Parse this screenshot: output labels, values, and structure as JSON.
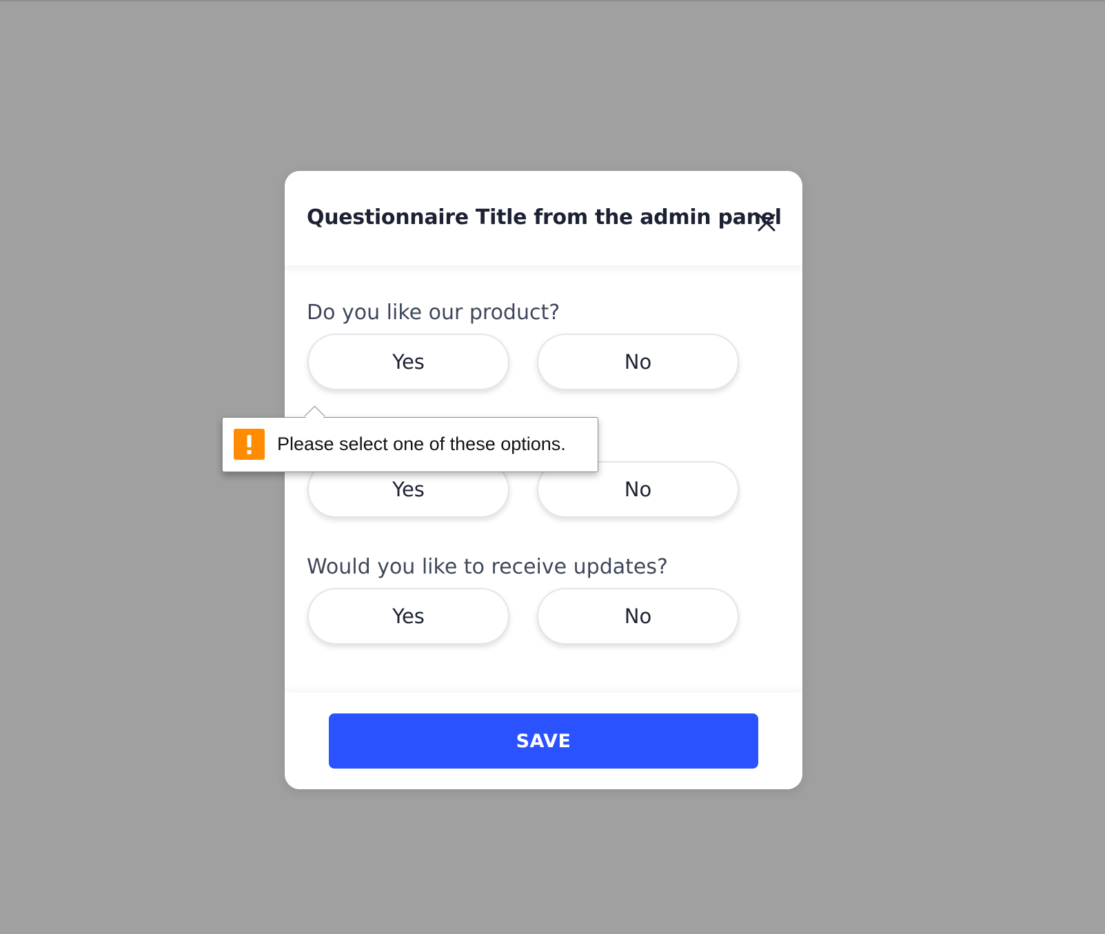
{
  "dialog": {
    "title": "Questionnaire Title from the admin panel",
    "close_icon": "close-icon"
  },
  "questions": [
    {
      "text": "Do you like our product?",
      "yes": "Yes",
      "no": "No"
    },
    {
      "text": "",
      "yes": "Yes",
      "no": "No"
    },
    {
      "text": "Would you like to receive updates?",
      "yes": "Yes",
      "no": "No"
    }
  ],
  "validation_tooltip": {
    "message": "Please select one of these options.",
    "icon": "warning-icon"
  },
  "footer": {
    "save_label": "SAVE"
  },
  "colors": {
    "backdrop": "#a0a0a0",
    "primary": "#2b52ff",
    "warning": "#ff8c00",
    "title_text": "#1c2233",
    "question_text": "#3e4759"
  }
}
